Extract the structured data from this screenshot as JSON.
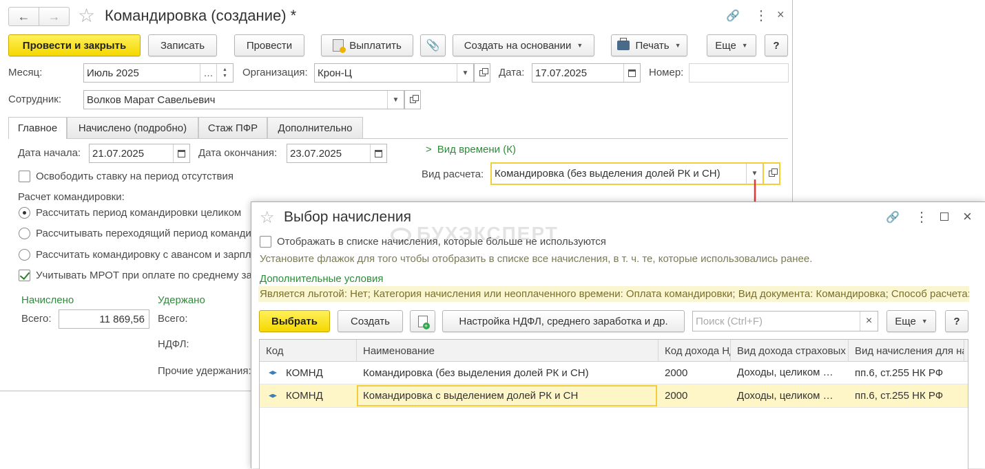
{
  "doc": {
    "title": "Командировка (создание) *",
    "toolbar": {
      "post_close": "Провести и закрыть",
      "save": "Записать",
      "post": "Провести",
      "pay": "Выплатить",
      "create_based": "Создать на основании",
      "print": "Печать",
      "more": "Еще",
      "help": "?"
    },
    "month_label": "Месяц:",
    "month_value": "Июль 2025",
    "org_label": "Организация:",
    "org_value": "Крон-Ц",
    "date_label": "Дата:",
    "date_value": "17.07.2025",
    "number_label": "Номер:",
    "number_value": "",
    "employee_label": "Сотрудник:",
    "employee_value": "Волков Марат Савельевич",
    "tabs": [
      "Главное",
      "Начислено (подробно)",
      "Стаж ПФР",
      "Дополнительно"
    ],
    "start_label": "Дата начала:",
    "start_value": "21.07.2025",
    "end_label": "Дата окончания:",
    "end_value": "23.07.2025",
    "time_kind_link": "Вид времени (К)",
    "release_rate": "Освободить ставку на период отсутствия",
    "calc_kind_label": "Вид расчета:",
    "calc_kind_value": "Командировка (без выделения долей РК и СН)",
    "calc_section": "Расчет командировки:",
    "radios": [
      "Рассчитать период командировки целиком",
      "Рассчитывать переходящий период командировки",
      "Рассчитать командировку с авансом и зарплатой"
    ],
    "mrot": "Учитывать МРОТ при оплате по среднему заработку",
    "accrued_title": "Начислено",
    "accrued_total_label": "Всего:",
    "accrued_total_value": "11 869,56",
    "withheld_title": "Удержано",
    "withheld_total_label": "Всего:",
    "ndfl_label": "НДФЛ:",
    "other_withholdings_label": "Прочие удержания:"
  },
  "dialog": {
    "title": "Выбор начисления",
    "show_unused": "Отображать в списке начисления, которые больше не используются",
    "hint": "Установите флажок для того чтобы отобразить в списке все начисления, в т. ч. те, которые использовались ранее.",
    "extra_conditions": "Дополнительные условия",
    "conditions_text": "Является льготой: Нет; Категория начисления или неоплаченного времени: Оплата командировки; Вид документа: Командировка; Способ расчета: ...",
    "toolbar": {
      "select": "Выбрать",
      "create": "Создать",
      "settings": "Настройка НДФЛ, среднего заработка и др.",
      "more": "Еще",
      "help": "?"
    },
    "search_placeholder": "Поиск (Ctrl+F)",
    "columns": [
      "Код",
      "Наименование",
      "Код дохода НДФЛ",
      "Вид дохода страховых взносов",
      "Вид начисления для налога на прибыль"
    ],
    "rows": [
      {
        "code": "КОМНД",
        "name": "Командировка (без выделения долей РК и СН)",
        "ndfl": "2000",
        "insurance": "Доходы, целиком облагаемые страховыми взносами",
        "profit": "пп.6, ст.255 НК РФ"
      },
      {
        "code": "КОМНД",
        "name": "Командировка с выделением долей РК и СН",
        "ndfl": "2000",
        "insurance": "Доходы, целиком облагаемые страховыми взносами",
        "profit": "пп.6, ст.255 НК РФ"
      }
    ]
  },
  "watermark": "БУХЭКСПЕРТ",
  "colors": {
    "accent_yellow": "#f5d800",
    "link_green": "#2e8b3a",
    "arrow_red": "#e53935",
    "selected_row": "#fff6c8"
  }
}
